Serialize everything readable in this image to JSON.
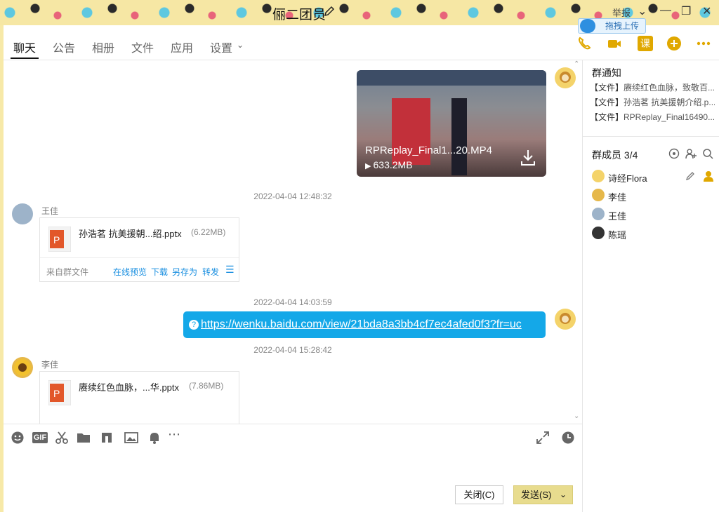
{
  "window": {
    "title": "俪二团员",
    "report_label": "举报",
    "upload_tip": "拖拽上传"
  },
  "tabs": [
    {
      "label": "聊天",
      "active": true
    },
    {
      "label": "公告"
    },
    {
      "label": "相册"
    },
    {
      "label": "文件"
    },
    {
      "label": "应用"
    },
    {
      "label": "设置"
    }
  ],
  "toolbar_right": {
    "course_label": "课"
  },
  "messages": {
    "video": {
      "filename": "RPReplay_Final1...20.MP4",
      "size": "633.2MB"
    },
    "ts1": "2022-04-04 12:48:32",
    "file1": {
      "sender": "王佳",
      "filename": "孙浩茗 抗美援朝...绍.pptx",
      "size": "(6.22MB)",
      "source": "来自群文件",
      "actions": [
        "在线预览",
        "下载",
        "另存为",
        "转发"
      ]
    },
    "ts2": "2022-04-04 14:03:59",
    "link": "https://wenku.baidu.com/view/21bda8a3bb4cf7ec4afed0f3?fr=uc",
    "ts3": "2022-04-04 15:28:42",
    "file2": {
      "sender": "李佳",
      "filename": "赓续红色血脉，...华.pptx",
      "size": "(7.86MB)"
    }
  },
  "input": {
    "close_label": "关闭(C)",
    "send_label": "发送(S)"
  },
  "sidebar": {
    "notice_title": "群通知",
    "notices": [
      {
        "tag": "【文件】",
        "text": "赓续红色血脉，致敬百..."
      },
      {
        "tag": "【文件】",
        "text": "孙浩茗 抗美援朝介绍.p..."
      },
      {
        "tag": "【文件】",
        "text": "RPReplay_Final16490..."
      }
    ],
    "members_title": "群成员 3/4",
    "members": [
      {
        "name": "诗经Flora"
      },
      {
        "name": "李佳"
      },
      {
        "name": "王佳"
      },
      {
        "name": "陈瑶"
      }
    ]
  },
  "colors": {
    "accent_blue": "#14a8e8",
    "link_blue": "#1a8fe0",
    "icon_orange": "#e0a800",
    "send_button": "#e8dc8e"
  }
}
